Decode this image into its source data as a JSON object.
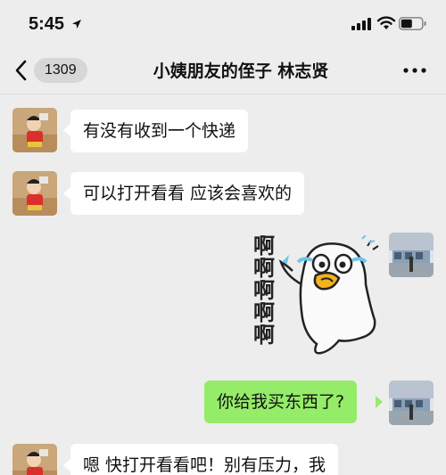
{
  "status_bar": {
    "time": "5:45"
  },
  "header": {
    "unread_count": "1309",
    "title": "小姨朋友的侄子 林志贤"
  },
  "messages": [
    {
      "side": "incoming",
      "text": "有没有收到一个快递"
    },
    {
      "side": "incoming",
      "text": "可以打开看看 应该会喜欢的"
    },
    {
      "side": "outgoing",
      "type": "sticker",
      "sticker_text": [
        "啊",
        "啊",
        "啊",
        "啊",
        "啊"
      ]
    },
    {
      "side": "outgoing",
      "text": "你给我买东西了?"
    },
    {
      "side": "incoming",
      "text": "嗯 快打开看看吧！别有压力，我"
    }
  ],
  "colors": {
    "background": "#ededed",
    "incoming_bubble": "#ffffff",
    "outgoing_bubble": "#95ec69"
  }
}
